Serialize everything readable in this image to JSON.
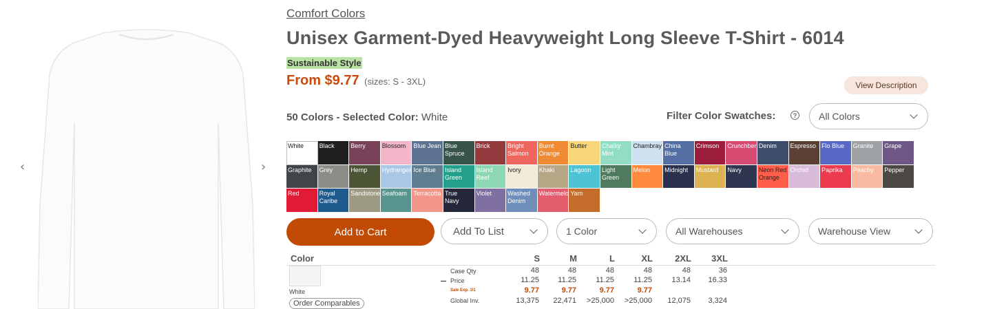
{
  "product": {
    "brand": "Comfort Colors",
    "title": "Unisex Garment-Dyed Heavyweight Long Sleeve T-Shirt - 6014",
    "badge": "Sustainable Style",
    "price": "From $9.77",
    "sizes": "(sizes: S - 3XL)",
    "view_description": "View Description"
  },
  "colors": {
    "count_label": "50 Colors - Selected Color:",
    "selected": "White",
    "filter_label": "Filter Color Swatches:",
    "filter_value": "All Colors"
  },
  "swatches": [
    {
      "name": "White",
      "color": "#ffffff",
      "dark": true
    },
    {
      "name": "Black",
      "color": "#1f1f1f"
    },
    {
      "name": "Berry",
      "color": "#7a4259"
    },
    {
      "name": "Blossom",
      "color": "#f3b6c8",
      "dark": true
    },
    {
      "name": "Blue Jean",
      "color": "#5d7391"
    },
    {
      "name": "Blue Spruce",
      "color": "#385449"
    },
    {
      "name": "Brick",
      "color": "#933a3f"
    },
    {
      "name": "Bright Salmon",
      "color": "#ef665f"
    },
    {
      "name": "Burnt Orange",
      "color": "#f08a33"
    },
    {
      "name": "Butter",
      "color": "#f7d77a",
      "dark": true
    },
    {
      "name": "Chalky Mint",
      "color": "#93dcc5"
    },
    {
      "name": "Chambray",
      "color": "#cfe1f0",
      "dark": true
    },
    {
      "name": "China Blue",
      "color": "#546fa4"
    },
    {
      "name": "Crimson",
      "color": "#9b1d39"
    },
    {
      "name": "Crunchberry",
      "color": "#d74a71"
    },
    {
      "name": "Denim",
      "color": "#3e4e6b"
    },
    {
      "name": "Espresso",
      "color": "#5a4033"
    },
    {
      "name": "Flo Blue",
      "color": "#5868c5"
    },
    {
      "name": "Granite",
      "color": "#9fa2a4"
    },
    {
      "name": "Grape",
      "color": "#6e5784"
    },
    {
      "name": "Graphite",
      "color": "#414548"
    },
    {
      "name": "Grey",
      "color": "#8e8c86"
    },
    {
      "name": "Hemp",
      "color": "#4c5536"
    },
    {
      "name": "Hydrangea",
      "color": "#a9c8e6"
    },
    {
      "name": "Ice Blue",
      "color": "#5e7d8e"
    },
    {
      "name": "Island Green",
      "color": "#22a08b"
    },
    {
      "name": "Island Reef",
      "color": "#8ed7b4"
    },
    {
      "name": "Ivory",
      "color": "#f1ead8",
      "dark": true
    },
    {
      "name": "Khaki",
      "color": "#b8a786"
    },
    {
      "name": "Lagoon",
      "color": "#4ec3d4"
    },
    {
      "name": "Light Green",
      "color": "#4f7a5d"
    },
    {
      "name": "Melon",
      "color": "#ff8a3d"
    },
    {
      "name": "Midnight",
      "color": "#2b314d"
    },
    {
      "name": "Mustard",
      "color": "#dcb252"
    },
    {
      "name": "Navy",
      "color": "#2e3650"
    },
    {
      "name": "Neon Red Orange",
      "color": "#ff5f4a",
      "dark": true
    },
    {
      "name": "Orchid",
      "color": "#d8bcd9"
    },
    {
      "name": "Paprika",
      "color": "#ec3a4f"
    },
    {
      "name": "Peachy",
      "color": "#f8bba1"
    },
    {
      "name": "Pepper",
      "color": "#4b4846"
    },
    {
      "name": "Red",
      "color": "#e11b36"
    },
    {
      "name": "Royal Caribe",
      "color": "#1e5a8d"
    },
    {
      "name": "Sandstone",
      "color": "#9d9a83"
    },
    {
      "name": "Seafoam",
      "color": "#58958f"
    },
    {
      "name": "Terracotta",
      "color": "#f2968a"
    },
    {
      "name": "True Navy",
      "color": "#25283a"
    },
    {
      "name": "Violet",
      "color": "#7f70a1"
    },
    {
      "name": "Washed Denim",
      "color": "#6f8eb9"
    },
    {
      "name": "Watermelon",
      "color": "#e45d6e"
    },
    {
      "name": "Yam",
      "color": "#c46d2b"
    }
  ],
  "actions": {
    "add_to_cart": "Add to Cart",
    "add_to_list": "Add To List",
    "color_count": "1 Color",
    "warehouses": "All Warehouses",
    "warehouse_view": "Warehouse View"
  },
  "table": {
    "color_header": "Color",
    "sizes": [
      "S",
      "M",
      "L",
      "XL",
      "2XL",
      "3XL"
    ],
    "row_color": "White",
    "order_comparables": "Order Comparables",
    "labels": {
      "case_qty": "Case Qty",
      "price": "Price",
      "sale": "Sale Exp. 1/1",
      "inventory": "Global Inv."
    },
    "case_qty": [
      "48",
      "48",
      "48",
      "48",
      "48",
      "36"
    ],
    "price": [
      "11.25",
      "11.25",
      "11.25",
      "11.25",
      "13.14",
      "16.33"
    ],
    "sale_price": [
      "9.77",
      "9.77",
      "9.77",
      "9.77",
      "",
      ""
    ],
    "inventory": [
      "13,375",
      "22,471",
      ">25,000",
      ">25,000",
      "12,075",
      "3,324"
    ]
  }
}
